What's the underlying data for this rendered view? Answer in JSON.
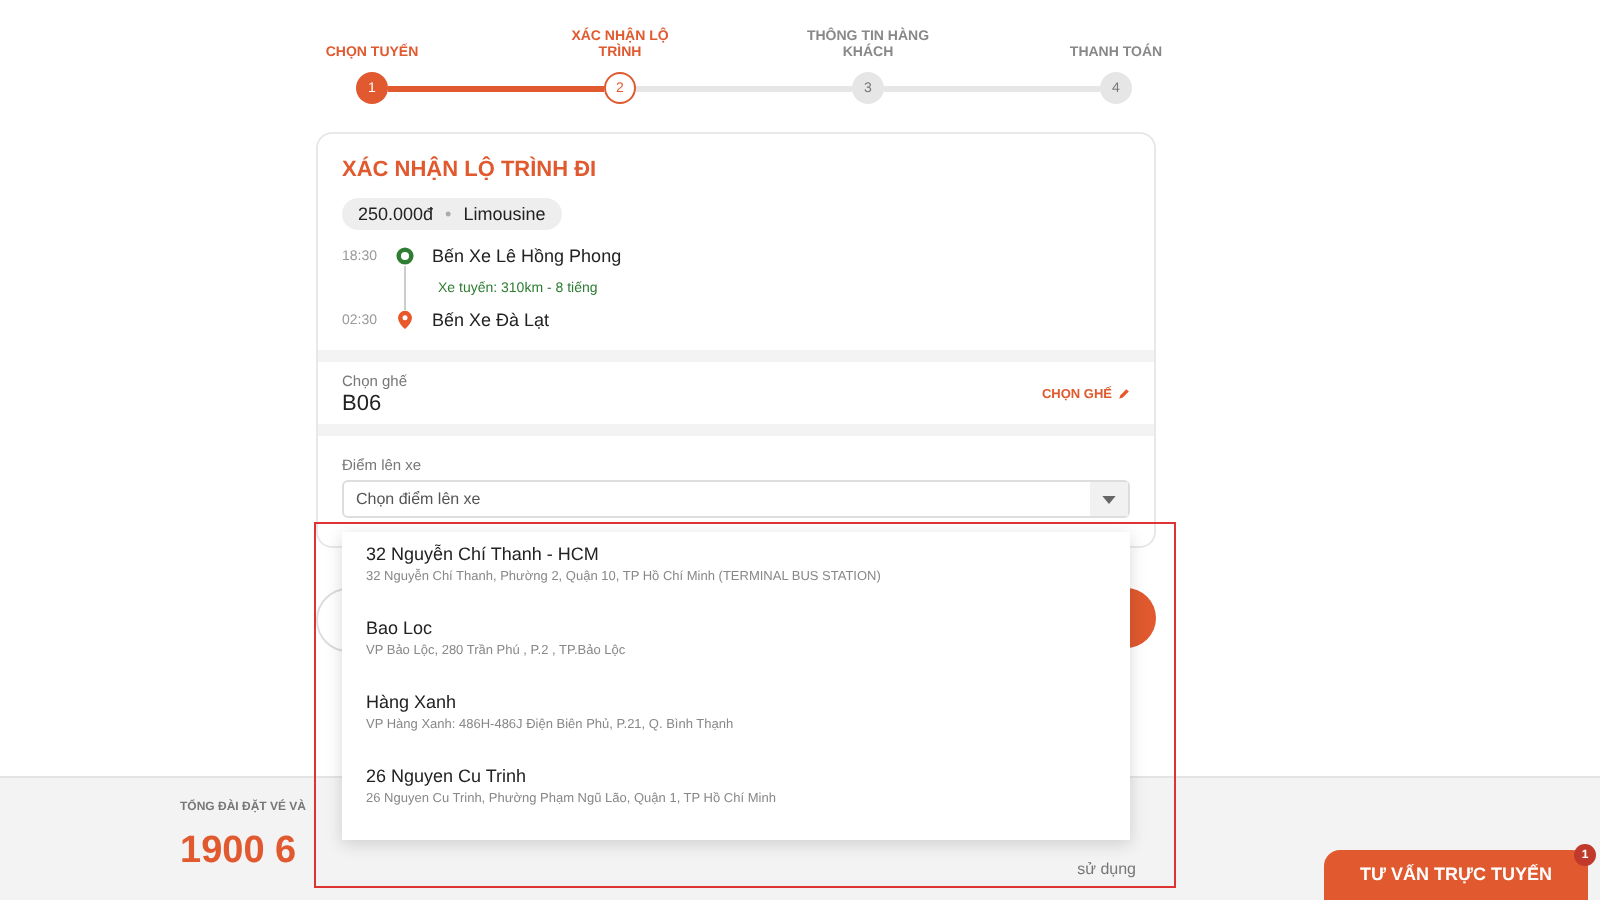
{
  "steps": [
    {
      "number": "1",
      "label": "CHỌN TUYẾN",
      "completed": true,
      "selected": false
    },
    {
      "number": "2",
      "label": "XÁC NHẬN LỘ TRÌNH",
      "completed": false,
      "selected": true
    },
    {
      "number": "3",
      "label": "THÔNG TIN HÀNG KHÁCH",
      "completed": false,
      "selected": false
    },
    {
      "number": "4",
      "label": "THANH TOÁN",
      "completed": false,
      "selected": false
    }
  ],
  "route": {
    "title": "XÁC NHẬN LỘ TRÌNH ĐI",
    "price": "250.000đ",
    "separator": "•",
    "vehicle": "Limousine",
    "stops": [
      {
        "time": "18:30",
        "name": "Bến Xe Lê Hồng Phong",
        "kind": "origin"
      },
      {
        "time": "02:30",
        "name": "Bến Xe Đà Lạt",
        "kind": "destination"
      }
    ],
    "trip_info": "Xe tuyến: 310km - 8 tiếng"
  },
  "seat": {
    "label": "Chọn ghế",
    "value": "B06",
    "action": "CHỌN GHẾ"
  },
  "pickup": {
    "label": "Điểm lên xe",
    "placeholder": "Chọn điểm lên xe",
    "expanded": true,
    "options": [
      {
        "name": "32 Nguyễn Chí Thanh - HCM",
        "address": "32 Nguyễn Chí Thanh, Phường 2, Quận 10, TP Hồ Chí Minh (TERMINAL BUS STATION)"
      },
      {
        "name": "Bao Loc",
        "address": "VP Bảo Lộc, 280 Trần Phú , P.2 , TP.Bảo Lộc"
      },
      {
        "name": "Hàng Xanh",
        "address": "VP Hàng Xanh: 486H-486J Điện Biên Phủ, P.21, Q. Bình Thạnh"
      },
      {
        "name": "26 Nguyen Cu Trinh",
        "address": "26 Nguyen Cu Trinh, Phường Phạm Ngũ Lão, Quận 1, TP Hồ Chí Minh"
      }
    ]
  },
  "footer": {
    "hotline_label": "TỔNG ĐÀI ĐẶT VÉ VÀ",
    "hotline": "1900 6",
    "note": "sử dụng"
  },
  "chat": {
    "label": "TƯ VẤN TRỰC TUYẾN",
    "badge": "1"
  }
}
